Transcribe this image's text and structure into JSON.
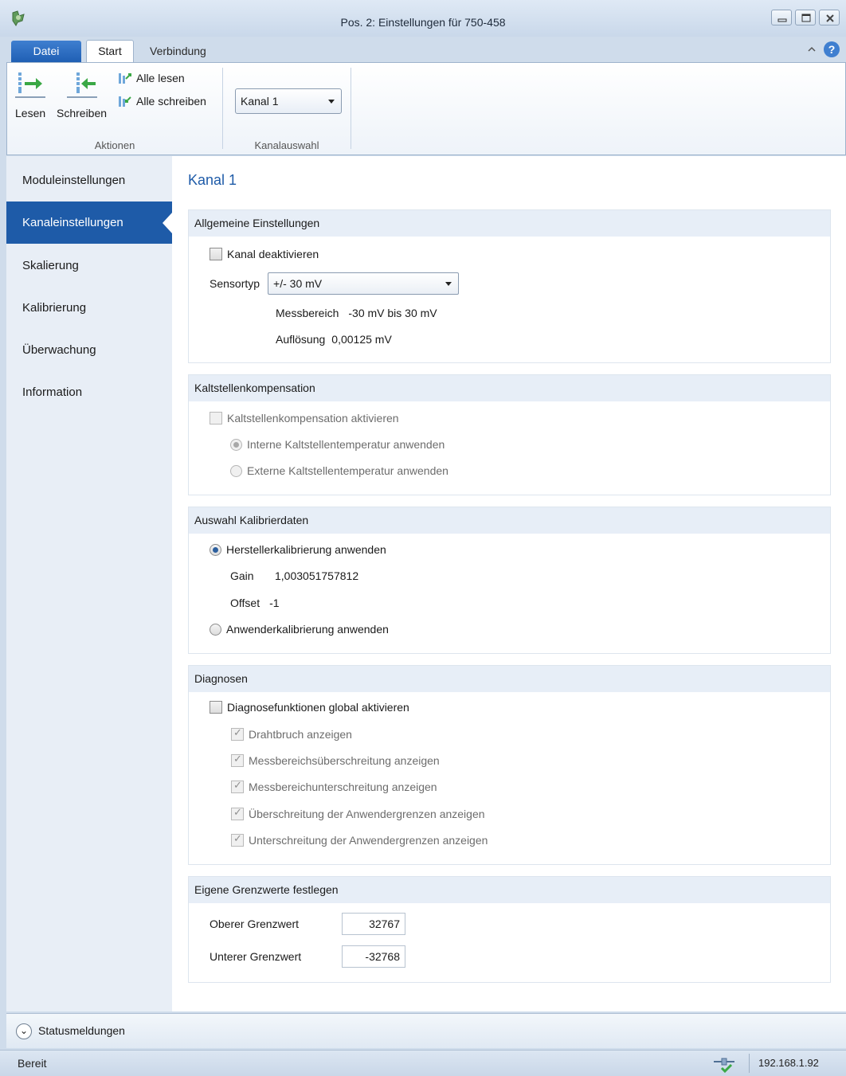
{
  "window": {
    "title": "Pos. 2: Einstellungen für 750-458"
  },
  "ribbon": {
    "tabs": {
      "datei": "Datei",
      "start": "Start",
      "verbindung": "Verbindung"
    },
    "actions": {
      "lesen": "Lesen",
      "schreiben": "Schreiben",
      "alle_lesen": "Alle lesen",
      "alle_schreiben": "Alle schreiben",
      "group_label": "Aktionen"
    },
    "kanalauswahl": {
      "selected": "Kanal 1",
      "group_label": "Kanalauswahl"
    }
  },
  "sidebar": {
    "items": [
      {
        "label": "Moduleinstellungen"
      },
      {
        "label": "Kanaleinstellungen"
      },
      {
        "label": "Skalierung"
      },
      {
        "label": "Kalibrierung"
      },
      {
        "label": "Überwachung"
      },
      {
        "label": "Information"
      }
    ]
  },
  "main": {
    "title": "Kanal 1",
    "allgemein": {
      "heading": "Allgemeine Einstellungen",
      "kanal_deaktivieren": "Kanal deaktivieren",
      "sensortyp_label": "Sensortyp",
      "sensortyp_value": "+/- 30 mV",
      "messbereich_label": "Messbereich",
      "messbereich_value": "-30 mV bis 30 mV",
      "aufloesung_label": "Auflösung",
      "aufloesung_value": "0,00125 mV"
    },
    "kaltstelle": {
      "heading": "Kaltstellenkompensation",
      "aktivieren": "Kaltstellenkompensation aktivieren",
      "intern": "Interne Kaltstellentemperatur anwenden",
      "extern": "Externe Kaltstellentemperatur anwenden"
    },
    "kalibrierdaten": {
      "heading": "Auswahl Kalibrierdaten",
      "hersteller": "Herstellerkalibrierung anwenden",
      "gain_label": "Gain",
      "gain_value": "1,003051757812",
      "offset_label": "Offset",
      "offset_value": "-1",
      "anwender": "Anwenderkalibrierung anwenden"
    },
    "diagnosen": {
      "heading": "Diagnosen",
      "global": "Diagnosefunktionen global aktivieren",
      "drahtbruch": "Drahtbruch anzeigen",
      "ueberschreitung": "Messbereichsüberschreitung anzeigen",
      "unterschreitung": "Messbereichunterschreitung anzeigen",
      "ueber_anwender": "Überschreitung der Anwendergrenzen anzeigen",
      "unter_anwender": "Unterschreitung der Anwendergrenzen anzeigen"
    },
    "grenzwerte": {
      "heading": "Eigene Grenzwerte festlegen",
      "oberer_label": "Oberer Grenzwert",
      "oberer_value": "32767",
      "unterer_label": "Unterer Grenzwert",
      "unterer_value": "-32768"
    }
  },
  "statusmessages": {
    "label": "Statusmeldungen"
  },
  "statusbar": {
    "state": "Bereit",
    "ip": "192.168.1.92"
  },
  "colors": {
    "accent": "#1e5ba8",
    "panel_header": "#e7eef7"
  }
}
